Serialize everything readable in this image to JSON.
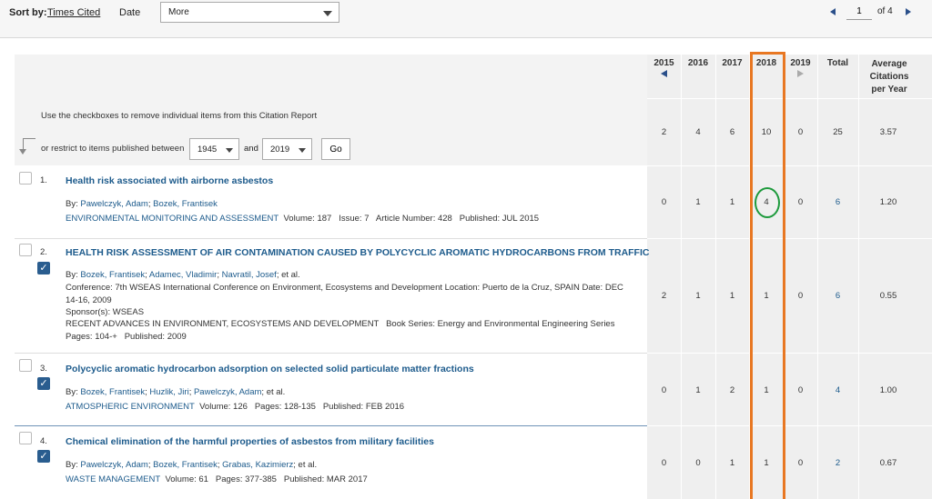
{
  "sort": {
    "label": "Sort by:",
    "times_cited": "Times Cited",
    "date": "Date",
    "more": "More"
  },
  "pager": {
    "page": "1",
    "of_label": "of 4"
  },
  "instructions": {
    "note": "Use the checkboxes to remove individual items from this Citation Report",
    "restrict": "or restrict to items published between",
    "from_year": "1945",
    "and_label": "and",
    "to_year": "2019",
    "go": "Go"
  },
  "columns": [
    "2015",
    "2016",
    "2017",
    "2018",
    "2019",
    "Total",
    "Average Citations per Year"
  ],
  "totals": [
    "2",
    "4",
    "6",
    "10",
    "0",
    "25",
    "3.57"
  ],
  "records": [
    {
      "num": "1.",
      "title": "Health risk associated with airborne asbestos",
      "by_label": "By:",
      "authors": [
        "Pawelczyk, Adam",
        "Bozek, Frantisek"
      ],
      "authors_tail": "",
      "line2_link": "ENVIRONMENTAL MONITORING AND ASSESSMENT",
      "line2_text": "Volume: 187   Issue: 7   Article Number: 428   Published: JUL 2015",
      "values": [
        "0",
        "1",
        "1",
        "4",
        "0",
        "6",
        "1.20"
      ]
    },
    {
      "num": "2.",
      "title": "HEALTH RISK ASSESSMENT OF AIR CONTAMINATION CAUSED BY POLYCYCLIC AROMATIC HYDROCARBONS FROM TRAFFIC",
      "by_label": "By:",
      "authors": [
        "Bozek, Frantisek",
        "Adamec, Vladimir",
        "Navratil, Josef"
      ],
      "authors_tail": "; et al.",
      "conference": "Conference: 7th WSEAS International Conference on Environment, Ecosystems and Development Location: Puerto de la Cruz, SPAIN Date: DEC 14-16, 2009",
      "sponsor": "Sponsor(s): WSEAS",
      "book": "RECENT ADVANCES IN ENVIRONMENT, ECOSYSTEMS AND DEVELOPMENT   Book Series: Energy and Environmental Engineering Series   Pages: 104-+   Published: 2009",
      "values": [
        "2",
        "1",
        "1",
        "1",
        "0",
        "6",
        "0.55"
      ]
    },
    {
      "num": "3.",
      "title": "Polycyclic aromatic hydrocarbon adsorption on selected solid particulate matter fractions",
      "by_label": "By:",
      "authors": [
        "Bozek, Frantisek",
        "Huzlik, Jiri",
        "Pawelczyk, Adam"
      ],
      "authors_tail": "; et al.",
      "line2_link": "ATMOSPHERIC ENVIRONMENT",
      "line2_text": "Volume: 126   Pages: 128-135   Published: FEB 2016",
      "values": [
        "0",
        "1",
        "2",
        "1",
        "0",
        "4",
        "1.00"
      ]
    },
    {
      "num": "4.",
      "title": "Chemical elimination of the harmful properties of asbestos from military facilities",
      "by_label": "By:",
      "authors": [
        "Pawelczyk, Adam",
        "Bozek, Frantisek",
        "Grabas, Kazimierz"
      ],
      "authors_tail": "; et al.",
      "line2_link": "WASTE MANAGEMENT",
      "line2_text": "Volume: 61   Pages: 377-385   Published: MAR 2017",
      "values": [
        "0",
        "0",
        "1",
        "1",
        "0",
        "2",
        "0.67"
      ]
    }
  ]
}
